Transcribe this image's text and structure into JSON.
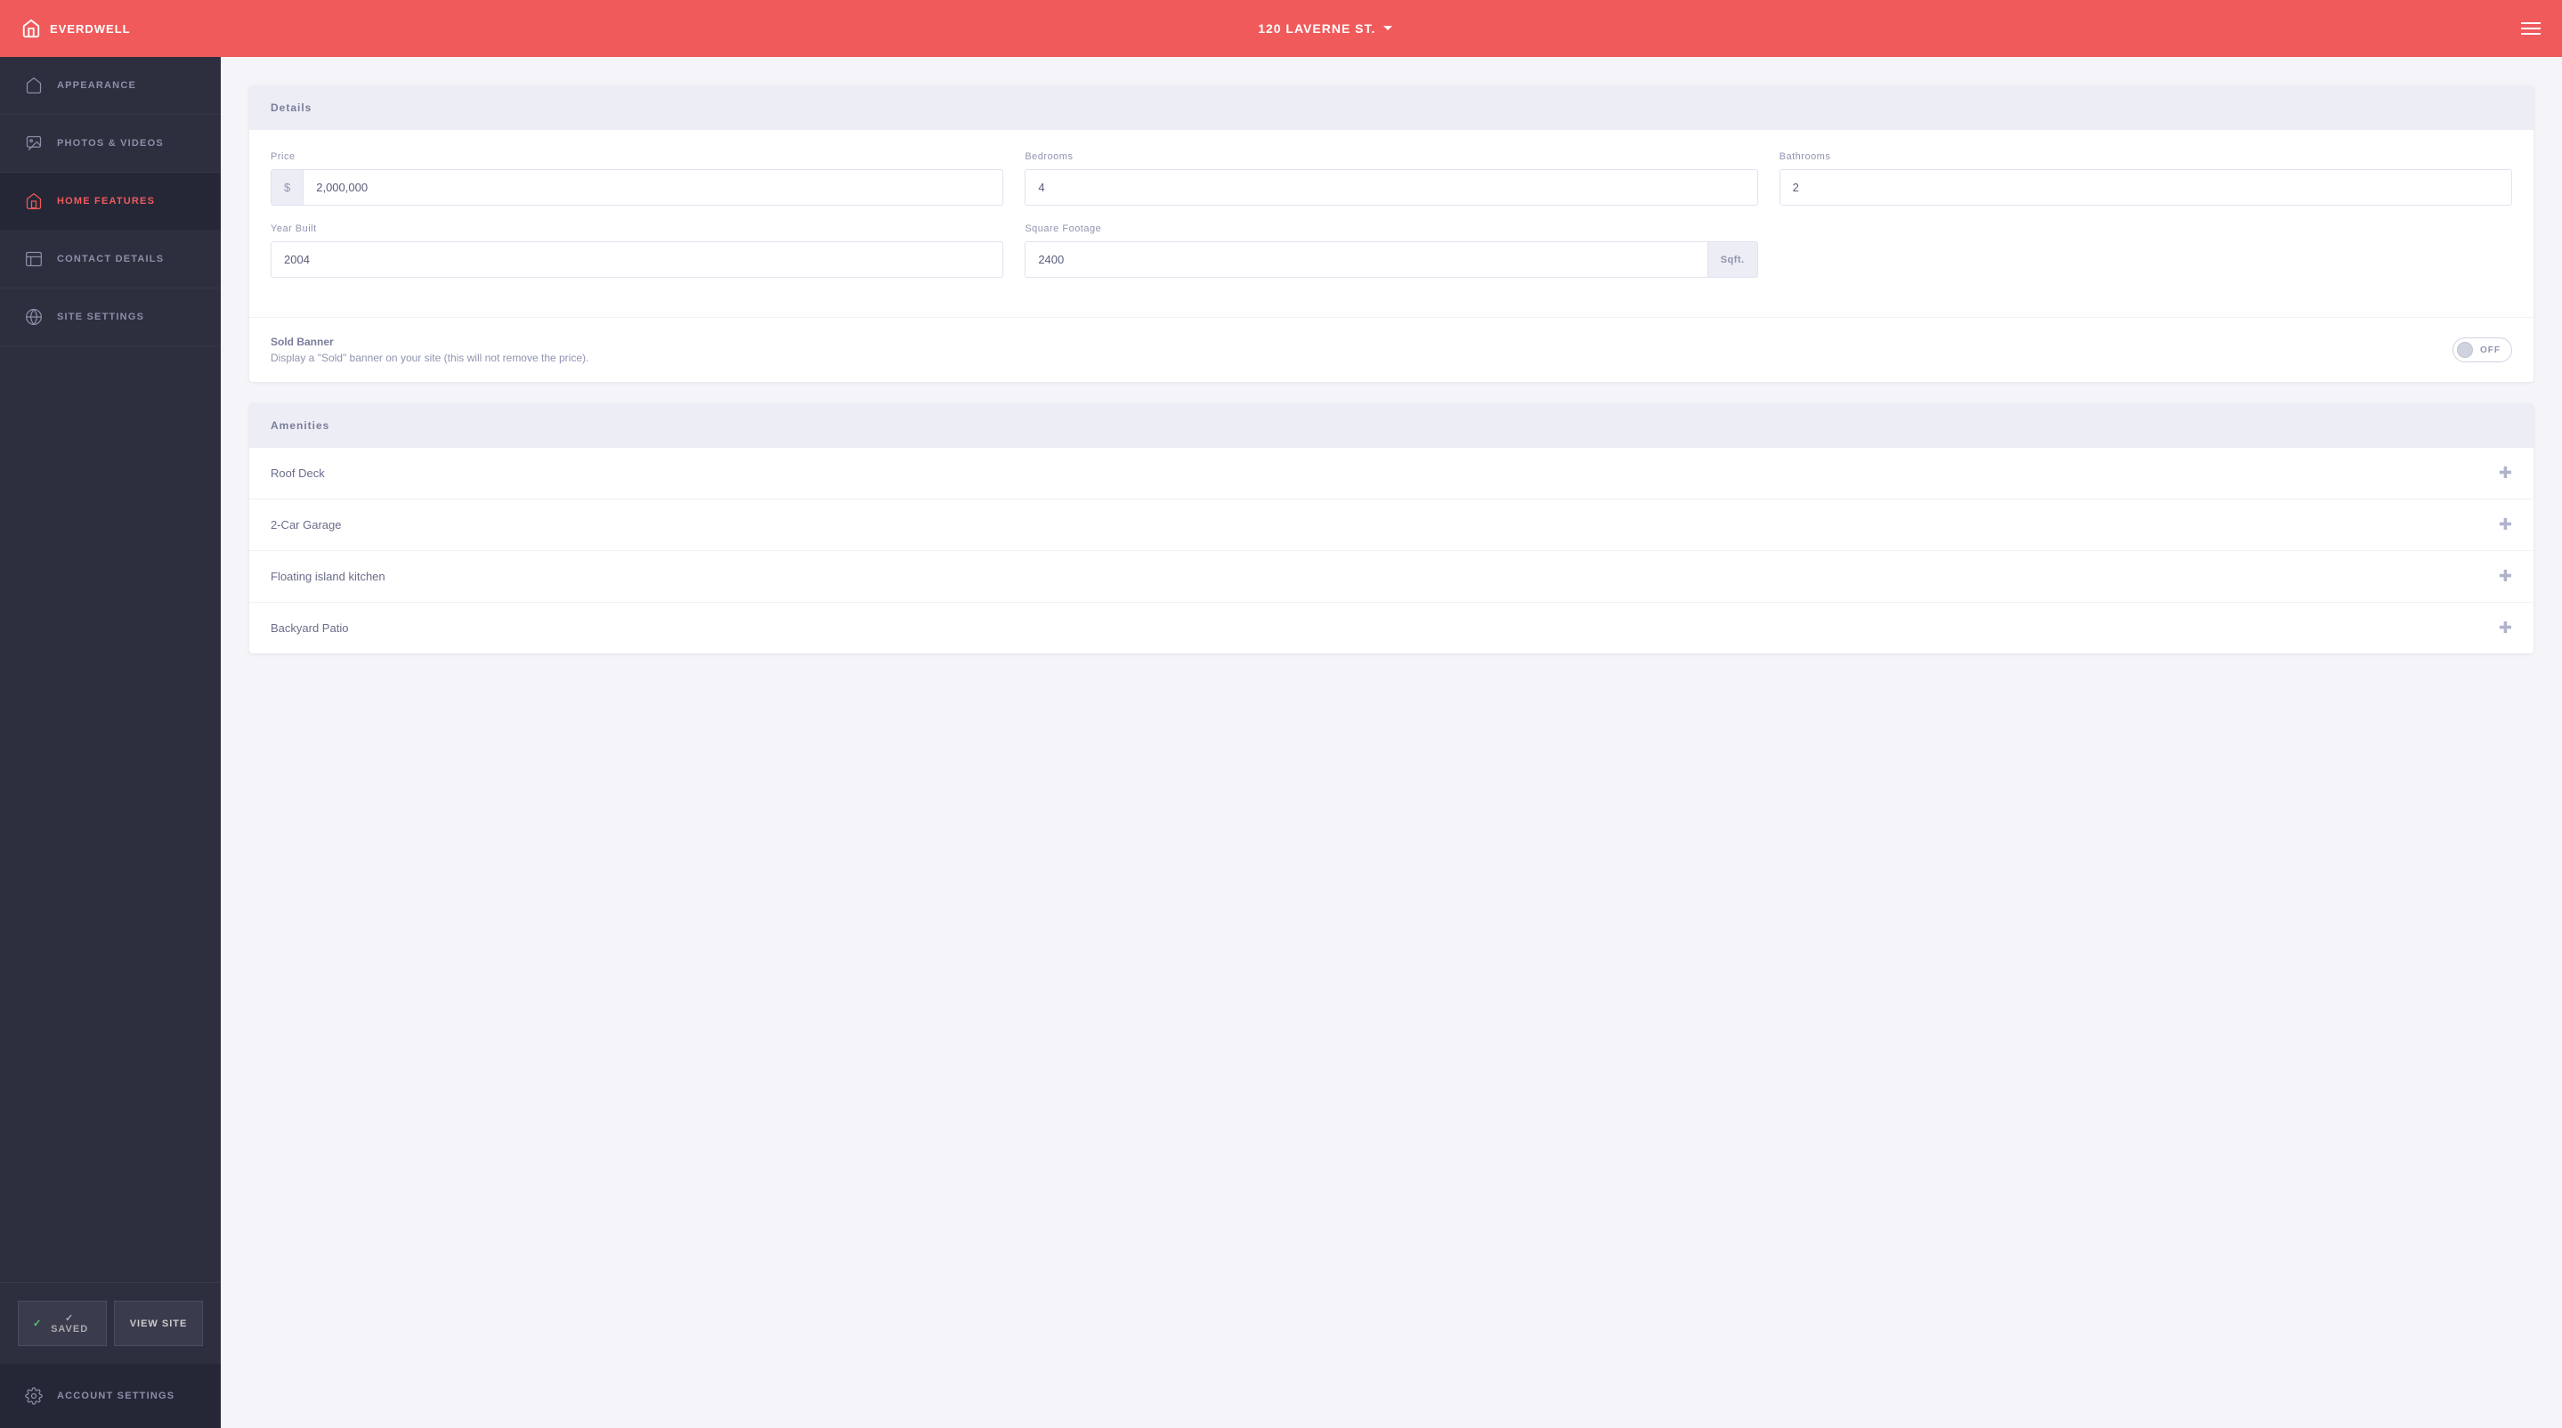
{
  "header": {
    "logo_text": "EVERDWELL",
    "property_title": "120 LAVERNE ST.",
    "menu_label": "menu"
  },
  "sidebar": {
    "items": [
      {
        "id": "appearance",
        "label": "APPEARANCE",
        "icon": "home-icon",
        "active": false
      },
      {
        "id": "photos-videos",
        "label": "PHOTOS & VIDEOS",
        "icon": "photo-icon",
        "active": false
      },
      {
        "id": "home-features",
        "label": "HOME FEATURES",
        "icon": "features-icon",
        "active": true
      },
      {
        "id": "contact-details",
        "label": "CONTACT DETAILS",
        "icon": "contact-icon",
        "active": false
      },
      {
        "id": "site-settings",
        "label": "SITE SETTINGS",
        "icon": "settings-icon",
        "active": false
      }
    ],
    "saved_button": "✓ SAVED",
    "view_site_button": "VIEW SITE",
    "account_settings": "ACCOUNT SETTINGS"
  },
  "details_section": {
    "header": "Details",
    "price_label": "Price",
    "price_prefix": "$",
    "price_value": "2,000,000",
    "bedrooms_label": "Bedrooms",
    "bedrooms_value": "4",
    "bathrooms_label": "Bathrooms",
    "bathrooms_value": "2",
    "year_built_label": "Year Built",
    "year_built_value": "2004",
    "sqft_label": "Square Footage",
    "sqft_value": "2400",
    "sqft_suffix": "Sqft.",
    "sold_banner_label": "Sold Banner",
    "sold_banner_desc": "Display a \"Sold\" banner on your site (this will not remove the price).",
    "toggle_state": "OFF"
  },
  "amenities_section": {
    "header": "Amenities",
    "items": [
      {
        "name": "Roof Deck"
      },
      {
        "name": "2-Car Garage"
      },
      {
        "name": "Floating island kitchen"
      },
      {
        "name": "Backyard Patio"
      }
    ]
  }
}
